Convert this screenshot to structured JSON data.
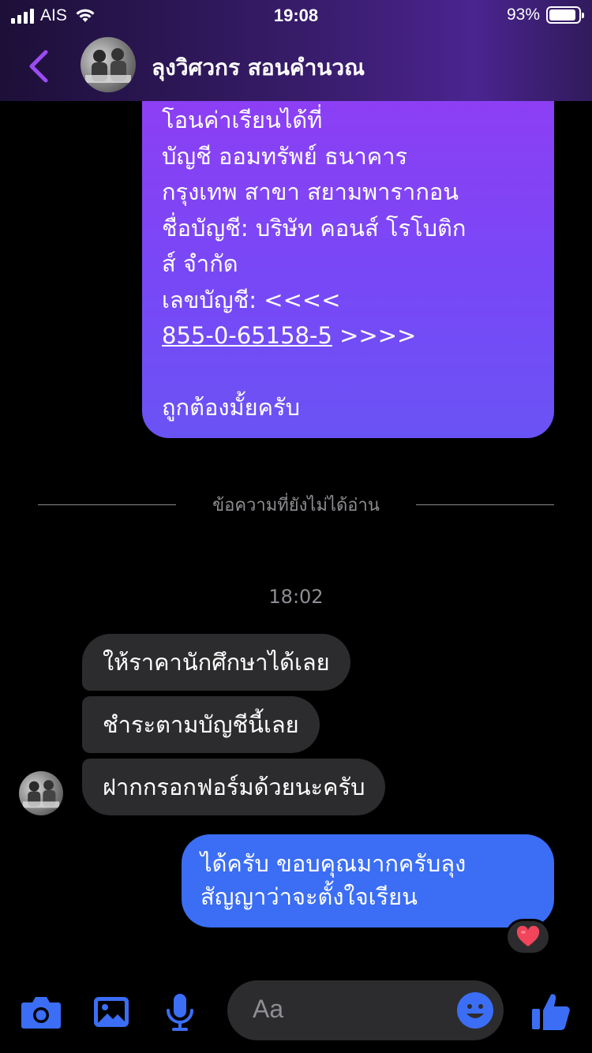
{
  "status": {
    "carrier": "AIS",
    "time": "19:08",
    "battery": "93%",
    "battery_level": 0.93
  },
  "header": {
    "contact_name": "ลุงวิศวกร สอนคำนวณ"
  },
  "messages": {
    "sent_top": {
      "line1": "โอนค่าเรียนได้ที่",
      "line2": "บัญชี ออมทรัพย์ ธนาคาร",
      "line3": "กรุงเทพ สาขา สยามพารากอน",
      "line4": "ชื่อบัญชี: บริษัท คอนส์ โรโบติก",
      "line5": "ส์ จำกัด",
      "line6": "เลขบัญชี: <<<<",
      "account_number": "855-0-65158-5",
      "account_suffix": " >>>>",
      "line8": "ถูกต้องมั้ยครับ"
    },
    "unread_divider": "ข้อความที่ยังไม่ได้อ่าน",
    "timestamp": "18:02",
    "received": [
      "ให้ราคานักศึกษาได้เลย",
      "ชำระตามบัญชีนี้เลย",
      "ฝากกรอกฟอร์มด้วยนะครับ"
    ],
    "sent_reply": {
      "line1": "ได้ครับ ขอบคุณมากครับลุง",
      "line2": "สัญญาว่าจะตั้งใจเรียน"
    },
    "reaction": "❤️"
  },
  "composer": {
    "placeholder": "Aa"
  },
  "colors": {
    "accent": "#3b6ef5",
    "bubble_top": "#8e3ef4",
    "bubble_bottom": "#6a53f5",
    "received_bubble": "#2c2c2e"
  },
  "icons": [
    "back-chevron-icon",
    "camera-icon",
    "gallery-icon",
    "microphone-icon",
    "emoji-icon",
    "thumbs-up-icon",
    "heart-reaction-icon"
  ]
}
